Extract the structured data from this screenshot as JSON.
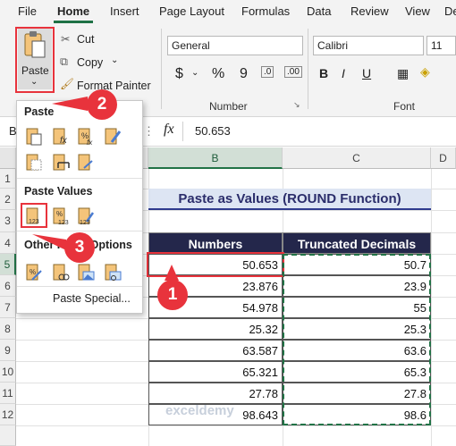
{
  "menu": {
    "tabs": [
      "File",
      "Home",
      "Insert",
      "Page Layout",
      "Formulas",
      "Data",
      "Review",
      "View",
      "De"
    ],
    "active": "Home"
  },
  "ribbon": {
    "paste_label": "Paste",
    "cut_label": "Cut",
    "copy_label": "Copy",
    "format_painter_label": "Format Painter",
    "number_format": "General",
    "currency_symbol": "$",
    "percent_symbol": "%",
    "comma_symbol": "9",
    "number_group_label": "Number",
    "font_name": "Calibri",
    "font_size": "11",
    "bold_label": "B",
    "italic_label": "I",
    "underline_label": "U",
    "font_group_label": "Font"
  },
  "formula_bar": {
    "name_box": "B",
    "fx": "fx",
    "value": "50.653"
  },
  "columns": [
    "B",
    "C",
    "D"
  ],
  "rows": [
    "1",
    "2",
    "3",
    "4",
    "5",
    "6",
    "7",
    "8",
    "9",
    "10",
    "11",
    "12"
  ],
  "dropdown": {
    "paste_section": "Paste",
    "paste_values_section": "Paste Values",
    "other_options_section": "Other Paste Options",
    "paste_special": "Paste Special..."
  },
  "table": {
    "title": "Paste as Values (ROUND Function)",
    "headers": [
      "Numbers",
      "Truncated Decimals"
    ],
    "rows": [
      [
        "50.653",
        "50.7"
      ],
      [
        "23.876",
        "23.9"
      ],
      [
        "54.978",
        "55"
      ],
      [
        "25.32",
        "25.3"
      ],
      [
        "63.587",
        "63.6"
      ],
      [
        "65.321",
        "65.3"
      ],
      [
        "27.78",
        "27.8"
      ],
      [
        "98.643",
        "98.6"
      ]
    ]
  },
  "badges": [
    "2",
    "3",
    "1"
  ],
  "watermark": "exceldemy",
  "colors": {
    "excel_green": "#217346",
    "header_navy": "#24274b",
    "title_bg": "#dde5f3",
    "callout_red": "#e8333c"
  }
}
